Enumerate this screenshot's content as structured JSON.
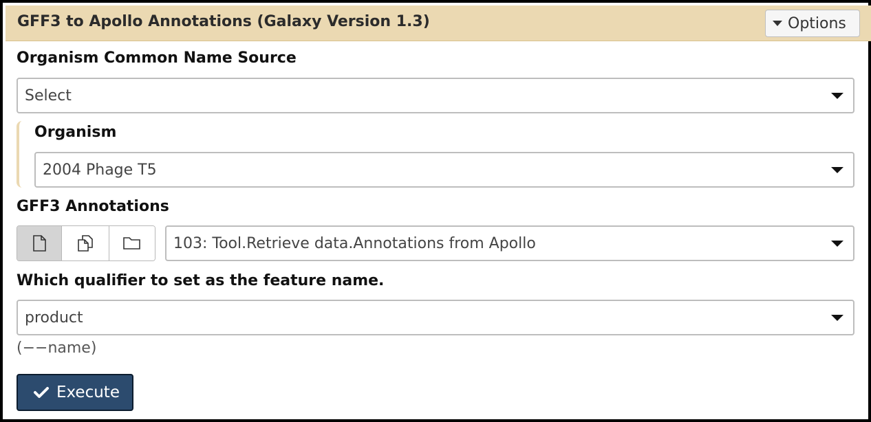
{
  "panel": {
    "title": "GFF3 to Apollo Annotations (Galaxy Version 1.3)",
    "options_label": "Options"
  },
  "fields": {
    "organism_source": {
      "label": "Organism Common Name Source",
      "value": "Select"
    },
    "organism": {
      "label": "Organism",
      "value": "2004 Phage T5"
    },
    "gff3": {
      "label": "GFF3 Annotations",
      "value": "103: Tool.Retrieve data.Annotations from Apollo",
      "mode_buttons": [
        "single-dataset-icon",
        "multiple-datasets-icon",
        "collection-folder-icon"
      ]
    },
    "name_qualifier": {
      "label": "Which qualifier to set as the feature name.",
      "value": "product",
      "help": "(−−name)"
    }
  },
  "actions": {
    "execute_label": "Execute"
  },
  "colors": {
    "header_bg": "#ebd9b2",
    "execute_bg": "#2c4b6e",
    "frame": "#000000"
  }
}
